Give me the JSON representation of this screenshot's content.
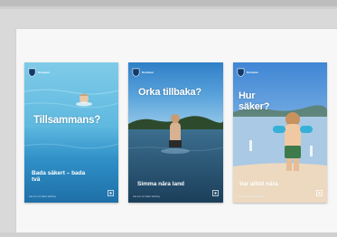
{
  "posters": [
    {
      "logo_text": "Kommun",
      "headline": "Tillsammans?",
      "tagline": "Bada säkert – bada tvä",
      "fineprint": "Läs mer om säker badning"
    },
    {
      "logo_text": "Kommun",
      "headline": "Orka tillbaka?",
      "tagline": "Simma nära land",
      "fineprint": "Läs mer om säker badning"
    },
    {
      "logo_text": "Kommun",
      "headline": "Hur säker?",
      "tagline": "Var alltid nära",
      "fineprint": "Läs mer om säker badning"
    }
  ],
  "colors": {
    "page_bg": "#d9d9d9",
    "card_bg": "#f7f7f7",
    "water_light": "#6fc6e8",
    "water_dark": "#1f6fa8",
    "lake_sky": "#3b8fcf",
    "beach_sky": "#4d8fd6"
  },
  "icons": [
    "municipality-shield-icon",
    "info-badge-icon"
  ]
}
